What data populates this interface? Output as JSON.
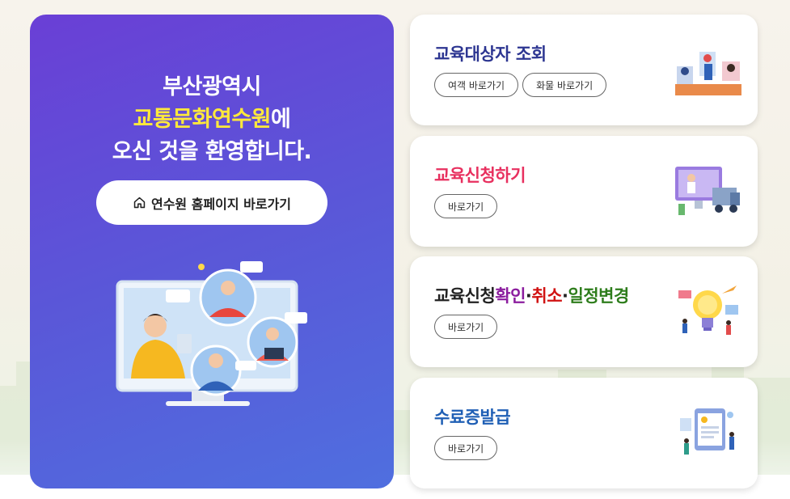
{
  "hero": {
    "title_line1": "부산광역시",
    "title_line2_highlight": "교통문화연수원",
    "title_line2_suffix": "에",
    "title_line3": "오신 것을 환영합니다.",
    "home_button_label": "연수원 홈페이지 바로가기",
    "home_icon": "home-icon",
    "illustration": "online-learning-illustration"
  },
  "cards": [
    {
      "title": "교육대상자 조회",
      "title_color": "#2c3591",
      "buttons": [
        "여객 바로가기",
        "화물 바로가기"
      ],
      "illustration": "training-lookup-illustration"
    },
    {
      "title": "교육신청하기",
      "title_color": "#e8305f",
      "buttons": [
        "바로가기"
      ],
      "illustration": "presenter-truck-illustration"
    },
    {
      "title_parts": [
        "교육신청",
        "확인",
        "·",
        "취소",
        "·",
        "일정변경"
      ],
      "title_colors": [
        "#222222",
        "#8b1c9e",
        "#222222",
        "#d11313",
        "#222222",
        "#2e7d1c"
      ],
      "buttons": [
        "바로가기"
      ],
      "illustration": "lightbulb-illustration"
    },
    {
      "title": "수료증발급",
      "title_color": "#1f5fb5",
      "buttons": [
        "바로가기"
      ],
      "illustration": "certificate-illustration"
    }
  ],
  "colors": {
    "hero_gradient_start": "#6a3fd6",
    "hero_gradient_end": "#4f6fdf",
    "highlight_yellow": "#ffe93b"
  }
}
